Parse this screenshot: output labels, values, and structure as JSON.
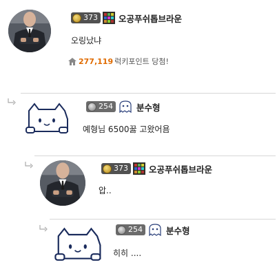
{
  "comments": [
    {
      "level": "373",
      "nickname": "오공푸쉬톱브라운",
      "text": "오링났냐",
      "points_value": "277,119",
      "points_suffix": "럭키포인트 당첨!"
    },
    {
      "level": "254",
      "nickname": "분수형",
      "text": "예형님 6500꿇 고왔어욤"
    },
    {
      "level": "373",
      "nickname": "오공푸쉬톱브라운",
      "text": "압.."
    },
    {
      "level": "254",
      "nickname": "분수형",
      "text": "히히 ...."
    }
  ],
  "icons": {
    "level_badge_gold": "gold-medal-icon",
    "level_badge_silver": "silver-medal-icon",
    "item_icon": "item-box-icon",
    "ghost": "ghost-icon",
    "reply": "reply-arrow-icon",
    "home": "home-icon"
  },
  "colors": {
    "points": "#e06b00",
    "level_badge": "#515151",
    "separator": "#d6d6d6"
  }
}
